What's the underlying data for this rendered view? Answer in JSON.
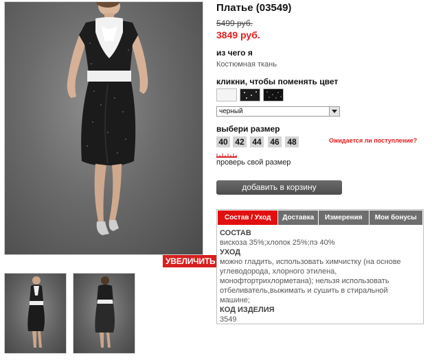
{
  "product": {
    "title": "Платье (03549)",
    "old_price": "5499 руб.",
    "new_price": "3849 руб."
  },
  "material": {
    "label": "из чего я",
    "value": "Костюмная ткань"
  },
  "color": {
    "label": "кликни, чтобы поменять цвет",
    "swatches": [
      "white",
      "black-white-dots",
      "black-dots"
    ],
    "selected": "черный"
  },
  "size": {
    "label": "выбери размер",
    "options": [
      "40",
      "42",
      "44",
      "46",
      "48"
    ],
    "await_link": "Ожидается ли поступление?",
    "check_link": "проверь свой размер"
  },
  "cart": {
    "button_label": "добавить в корзину"
  },
  "gallery": {
    "zoom_label": "УВЕЛИЧИТЬ"
  },
  "tabs": {
    "items": [
      "Состав / Уход",
      "Доставка",
      "Измерения",
      "Мои бонусы"
    ],
    "active": 0
  },
  "details": {
    "composition_title": "СОСТАВ",
    "composition": "вискоза 35%;хлопок 25%;пэ 40%",
    "care_title": "УХОД",
    "care_lines": [
      "можно гладить, использовать химчистку (на основе",
      "углеводорода, хлорного этилена,",
      "монофтортрихлорметана); нельзя использовать",
      "отбеливатель,выжимать и сушить в стиральной",
      "машине;"
    ],
    "code_title": "КОД ИЗДЕЛИЯ",
    "code": "3549"
  },
  "colors": {
    "accent_red": "#e31b1b",
    "tab_active": "#e01010",
    "tab_inactive": "#6e6e6e",
    "button": "#555555"
  }
}
